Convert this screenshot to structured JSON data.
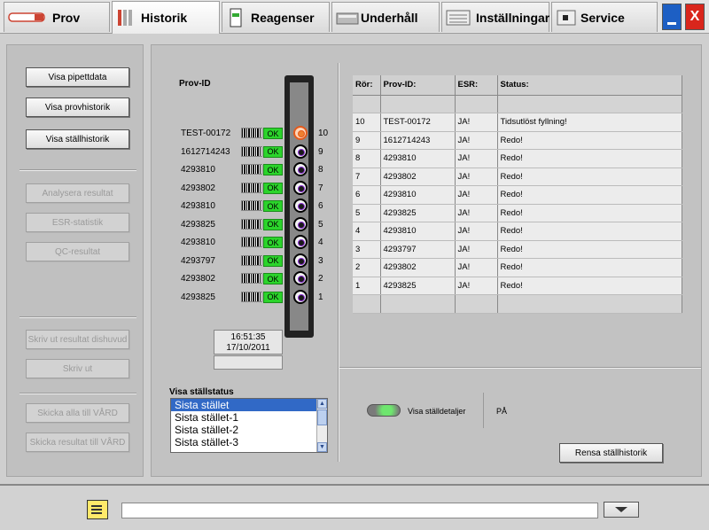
{
  "tabs": [
    {
      "label": "Prov",
      "icon": "sample-tube-icon"
    },
    {
      "label": "Historik",
      "icon": "history-icon"
    },
    {
      "label": "Reagenser",
      "icon": "reagents-icon"
    },
    {
      "label": "Underhåll",
      "icon": "maintenance-icon"
    },
    {
      "label": "Inställningar",
      "icon": "settings-icon"
    },
    {
      "label": "Service",
      "icon": "service-icon"
    }
  ],
  "active_tab": "Historik",
  "window": {
    "close_label": "X"
  },
  "sidebar": {
    "buttons": [
      {
        "label": "Visa pipettdata",
        "enabled": true
      },
      {
        "label": "Visa provhistorik",
        "enabled": true
      },
      {
        "label": "Visa ställhistorik",
        "enabled": true
      },
      {
        "label": "Analysera resultat",
        "enabled": false
      },
      {
        "label": "ESR-statistik",
        "enabled": false
      },
      {
        "label": "QC-resultat",
        "enabled": false
      },
      {
        "label": "Skriv ut resultat dishuvud",
        "enabled": false
      },
      {
        "label": "Skriv ut",
        "enabled": false
      },
      {
        "label": "Skicka alla till VÅRD",
        "enabled": false
      },
      {
        "label": "Skicka resultat till VÅRD",
        "enabled": false
      }
    ]
  },
  "rack": {
    "header": "Prov-ID",
    "rows": [
      {
        "id": "TEST-00172",
        "status": "OK",
        "position": "10",
        "warning": true
      },
      {
        "id": "1612714243",
        "status": "OK",
        "position": "9",
        "warning": false
      },
      {
        "id": "4293810",
        "status": "OK",
        "position": "8",
        "warning": false
      },
      {
        "id": "4293802",
        "status": "OK",
        "position": "7",
        "warning": false
      },
      {
        "id": "4293810",
        "status": "OK",
        "position": "6",
        "warning": false
      },
      {
        "id": "4293825",
        "status": "OK",
        "position": "5",
        "warning": false
      },
      {
        "id": "4293810",
        "status": "OK",
        "position": "4",
        "warning": false
      },
      {
        "id": "4293797",
        "status": "OK",
        "position": "3",
        "warning": false
      },
      {
        "id": "4293802",
        "status": "OK",
        "position": "2",
        "warning": false
      },
      {
        "id": "4293825",
        "status": "OK",
        "position": "1",
        "warning": false
      }
    ],
    "time": "16:51:35",
    "date": "17/10/2011"
  },
  "rack_status": {
    "label": "Visa ställstatus",
    "items": [
      "Sista stället",
      "Sista stället-1",
      "Sista stället-2",
      "Sista stället-3"
    ],
    "selected": 0
  },
  "history_table": {
    "headers": [
      "Rör:",
      "Prov-ID:",
      "ESR:",
      "Status:"
    ],
    "rows": [
      [
        "10",
        "TEST-00172",
        "JA!",
        "Tidsutlöst fyllning!"
      ],
      [
        "9",
        "1612714243",
        "JA!",
        "Redo!"
      ],
      [
        "8",
        "4293810",
        "JA!",
        "Redo!"
      ],
      [
        "7",
        "4293802",
        "JA!",
        "Redo!"
      ],
      [
        "6",
        "4293810",
        "JA!",
        "Redo!"
      ],
      [
        "5",
        "4293825",
        "JA!",
        "Redo!"
      ],
      [
        "4",
        "4293810",
        "JA!",
        "Redo!"
      ],
      [
        "3",
        "4293797",
        "JA!",
        "Redo!"
      ],
      [
        "2",
        "4293802",
        "JA!",
        "Redo!"
      ],
      [
        "1",
        "4293825",
        "JA!",
        "Redo!"
      ]
    ]
  },
  "detail_toggle": {
    "label": "Visa ställdetaljer",
    "value": "PÅ"
  },
  "clear_button": {
    "label": "Rensa ställhistorik"
  },
  "bottom": {
    "message": ""
  }
}
